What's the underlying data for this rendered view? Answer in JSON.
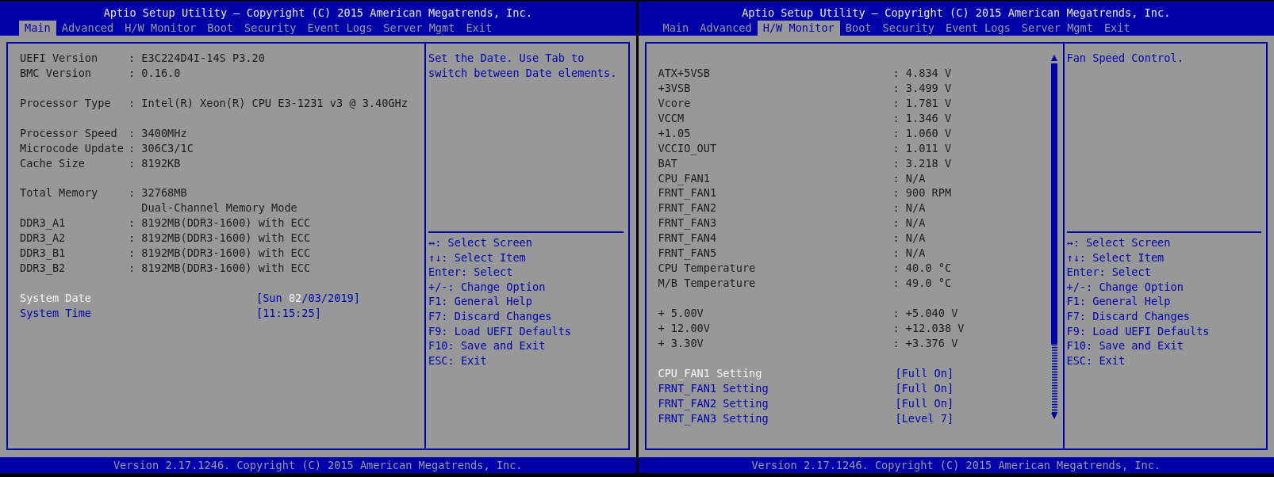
{
  "screens": [
    {
      "title": "Aptio Setup Utility – Copyright (C) 2015 American Megatrends, Inc.",
      "tabs": [
        {
          "label": "Main",
          "selected": true
        },
        {
          "label": "Advanced",
          "selected": false
        },
        {
          "label": "H/W Monitor",
          "selected": false
        },
        {
          "label": "Boot",
          "selected": false
        },
        {
          "label": "Security",
          "selected": false
        },
        {
          "label": "Event Logs",
          "selected": false
        },
        {
          "label": "Server Mgmt",
          "selected": false
        },
        {
          "label": "Exit",
          "selected": false
        }
      ],
      "scrollbar": false,
      "rows": [
        {
          "kind": "info",
          "label": "UEFI Version",
          "value": ": E3C224D4I-14S P3.20"
        },
        {
          "kind": "info",
          "label": "BMC Version",
          "value": ": 0.16.0"
        },
        {
          "kind": "blank"
        },
        {
          "kind": "info",
          "label": "Processor Type",
          "value": ": Intel(R) Xeon(R) CPU E3-1231 v3 @ 3.40GHz"
        },
        {
          "kind": "blank"
        },
        {
          "kind": "info",
          "label": "Processor Speed",
          "value": ": 3400MHz"
        },
        {
          "kind": "info",
          "label": "Microcode Update",
          "value": ": 306C3/1C"
        },
        {
          "kind": "info",
          "label": "Cache Size",
          "value": ": 8192KB"
        },
        {
          "kind": "blank"
        },
        {
          "kind": "info",
          "label": "Total Memory",
          "value": ": 32768MB"
        },
        {
          "kind": "cont",
          "value": "Dual-Channel Memory Mode"
        },
        {
          "kind": "info",
          "label": "DDR3_A1",
          "value": ": 8192MB(DDR3-1600) with ECC"
        },
        {
          "kind": "info",
          "label": "DDR3_A2",
          "value": ": 8192MB(DDR3-1600) with ECC"
        },
        {
          "kind": "info",
          "label": "DDR3_B1",
          "value": ": 8192MB(DDR3-1600) with ECC"
        },
        {
          "kind": "info",
          "label": "DDR3_B2",
          "value": ": 8192MB(DDR3-1600) with ECC"
        },
        {
          "kind": "blank"
        },
        {
          "kind": "setting",
          "label": "System Date",
          "selected": true,
          "value_parts": [
            {
              "text": "[Sun ",
              "highlighted": false
            },
            {
              "text": "02",
              "highlighted": true
            },
            {
              "text": "/03/2019]",
              "highlighted": false
            }
          ]
        },
        {
          "kind": "setting",
          "label": "System Time",
          "selected": false,
          "value": "[11:15:25]"
        }
      ],
      "help": "Set the Date. Use Tab to switch between Date elements.",
      "keys": [
        "↔: Select Screen",
        "↑↓: Select Item",
        "Enter: Select",
        "+/-: Change Option",
        "F1: General Help",
        "F7: Discard Changes",
        "F9: Load UEFI Defaults",
        "F10: Save and Exit",
        "ESC: Exit"
      ],
      "footer": "Version 2.17.1246. Copyright (C) 2015 American Megatrends, Inc."
    },
    {
      "title": "Aptio Setup Utility – Copyright (C) 2015 American Megatrends, Inc.",
      "tabs": [
        {
          "label": "Main",
          "selected": false
        },
        {
          "label": "Advanced",
          "selected": false
        },
        {
          "label": "H/W Monitor",
          "selected": true
        },
        {
          "label": "Boot",
          "selected": false
        },
        {
          "label": "Security",
          "selected": false
        },
        {
          "label": "Event Logs",
          "selected": false
        },
        {
          "label": "Server Mgmt",
          "selected": false
        },
        {
          "label": "Exit",
          "selected": false
        }
      ],
      "scrollbar": true,
      "rows": [
        {
          "kind": "blank"
        },
        {
          "kind": "info",
          "label": "ATX+5VSB",
          "value": ": 4.834 V"
        },
        {
          "kind": "info",
          "label": "+3VSB",
          "value": ": 3.499 V"
        },
        {
          "kind": "info",
          "label": "Vcore",
          "value": ": 1.781 V"
        },
        {
          "kind": "info",
          "label": "VCCM",
          "value": ": 1.346 V"
        },
        {
          "kind": "info",
          "label": "+1.05",
          "value": ": 1.060 V"
        },
        {
          "kind": "info",
          "label": "VCCIO_OUT",
          "value": ": 1.011 V"
        },
        {
          "kind": "info",
          "label": "BAT",
          "value": ": 3.218 V"
        },
        {
          "kind": "info",
          "label": "CPU_FAN1",
          "value": ": N/A"
        },
        {
          "kind": "info",
          "label": "FRNT_FAN1",
          "value": ": 900 RPM"
        },
        {
          "kind": "info",
          "label": "FRNT_FAN2",
          "value": ": N/A"
        },
        {
          "kind": "info",
          "label": "FRNT_FAN3",
          "value": ": N/A"
        },
        {
          "kind": "info",
          "label": "FRNT_FAN4",
          "value": ": N/A"
        },
        {
          "kind": "info",
          "label": "FRNT_FAN5",
          "value": ": N/A"
        },
        {
          "kind": "info",
          "label": "CPU Temperature",
          "value": ": 40.0 °C"
        },
        {
          "kind": "info",
          "label": "M/B Temperature",
          "value": ": 49.0 °C"
        },
        {
          "kind": "blank"
        },
        {
          "kind": "info",
          "label": "+ 5.00V",
          "value": ": +5.040 V"
        },
        {
          "kind": "info",
          "label": "+ 12.00V",
          "value": ": +12.038 V"
        },
        {
          "kind": "info",
          "label": "+ 3.30V",
          "value": ": +3.376 V"
        },
        {
          "kind": "blank"
        },
        {
          "kind": "setting",
          "label": "CPU_FAN1 Setting",
          "selected": true,
          "value": "[Full On]"
        },
        {
          "kind": "setting",
          "label": "FRNT_FAN1 Setting",
          "selected": false,
          "value": "[Full On]"
        },
        {
          "kind": "setting",
          "label": "FRNT_FAN2 Setting",
          "selected": false,
          "value": "[Full On]"
        },
        {
          "kind": "setting",
          "label": "FRNT_FAN3 Setting",
          "selected": false,
          "value": "[Level 7]"
        }
      ],
      "help": "Fan Speed Control.",
      "keys": [
        "↔: Select Screen",
        "↑↓: Select Item",
        "Enter: Select",
        "+/-: Change Option",
        "F1: General Help",
        "F7: Discard Changes",
        "F9: Load UEFI Defaults",
        "F10: Save and Exit",
        "ESC: Exit"
      ],
      "footer": "Version 2.17.1246. Copyright (C) 2015 American Megatrends, Inc."
    }
  ]
}
